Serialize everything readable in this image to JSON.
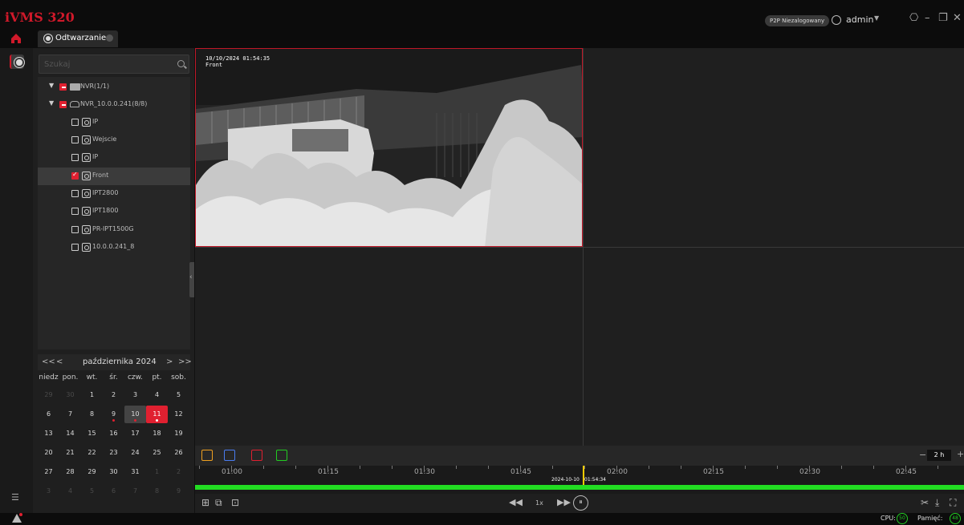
{
  "app": {
    "title": "iVMS 320"
  },
  "header": {
    "p2p_status": "P2P Niezalogowany",
    "user": "admin",
    "icons": [
      "user-circle-icon",
      "lock-icon",
      "minimize-icon",
      "restore-icon",
      "close-icon"
    ]
  },
  "tabs": [
    {
      "label": "Odtwarzanie"
    }
  ],
  "search": {
    "placeholder": "Szukaj"
  },
  "tree": {
    "root": {
      "label": "NVR(1/1)"
    },
    "nvr": {
      "label": "NVR_10.0.0.241(8/8)"
    },
    "cameras": [
      {
        "label": "IP",
        "checked": false
      },
      {
        "label": "Wejscie",
        "checked": false
      },
      {
        "label": "IP",
        "checked": false
      },
      {
        "label": "Front",
        "checked": true
      },
      {
        "label": "IPT2800",
        "checked": false
      },
      {
        "label": "IPT1800",
        "checked": false
      },
      {
        "label": "PR-IPT1500G",
        "checked": false
      },
      {
        "label": "10.0.0.241_8",
        "checked": false
      }
    ]
  },
  "calendar": {
    "nav": {
      "prev_year": "<<",
      "prev_month": "<",
      "next_month": ">",
      "next_year": ">>"
    },
    "title": "października 2024",
    "weekdays": [
      "niedz",
      "pon.",
      "wt.",
      "śr.",
      "czw.",
      "pt.",
      "sob."
    ],
    "weeks": [
      [
        "29",
        "30",
        "1",
        "2",
        "3",
        "4",
        "5"
      ],
      [
        "6",
        "7",
        "8",
        "9",
        "10",
        "11",
        "12"
      ],
      [
        "13",
        "14",
        "15",
        "16",
        "17",
        "18",
        "19"
      ],
      [
        "20",
        "21",
        "22",
        "23",
        "24",
        "25",
        "26"
      ],
      [
        "27",
        "28",
        "29",
        "30",
        "31",
        "1",
        "2"
      ],
      [
        "3",
        "4",
        "5",
        "6",
        "7",
        "8",
        "9"
      ]
    ],
    "today": "11",
    "selected": "10",
    "recorded_days": [
      "9",
      "10",
      "11"
    ]
  },
  "video": {
    "osd_time": "10/10/2024 01:54:35",
    "osd_name": "Front"
  },
  "toolstrip": {
    "filters": [
      {
        "name": "motion-filter-icon",
        "color": "#f0a020"
      },
      {
        "name": "ai-filter-icon",
        "color": "#4a7cf0"
      },
      {
        "name": "alarm-filter-icon",
        "color": "#e02030"
      },
      {
        "name": "video-filter-icon",
        "color": "#22cc22"
      }
    ],
    "zoom_minus": "−",
    "zoom_value": "2 h",
    "zoom_plus": "+"
  },
  "timeline": {
    "labels": [
      "01:00",
      "01:15",
      "01:30",
      "01:45",
      "02:00",
      "02:15",
      "02:30",
      "02:45"
    ],
    "cursor_date": "2024-10-10",
    "cursor_time": "01:54:34",
    "colors": {
      "recording": "#22dd22",
      "cursor": "#ffcc00"
    }
  },
  "playback": {
    "speed": "1x",
    "rewind": "◀◀",
    "forward": "▶▶",
    "pause": "⏸"
  },
  "status": {
    "cpu_label": "CPU:",
    "cpu_value": "50",
    "mem_label": "Pamięć:",
    "mem_value": "48"
  },
  "colors": {
    "accent": "#e02030",
    "background": "#1f1f1f"
  }
}
